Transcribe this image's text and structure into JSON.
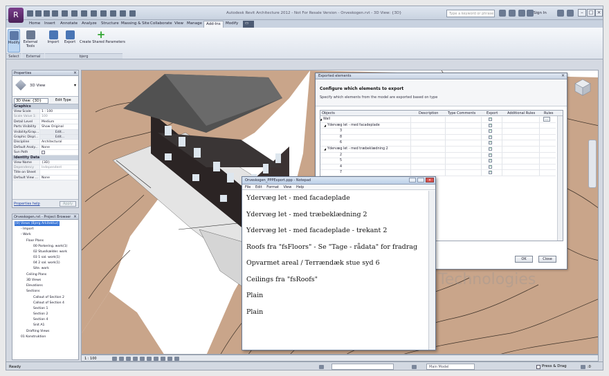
{
  "window": {
    "title": "Autodesk Revit Architecture 2012 - Not For Resale Version - Orveskogen.rvt - 3D View: {3D}",
    "search_placeholder": "Type a keyword or phrase",
    "sign_in": "Sign In"
  },
  "ribbon": {
    "tabs": [
      "Home",
      "Insert",
      "Annotate",
      "Analyze",
      "Structure",
      "Massing & Site",
      "Collaborate",
      "View",
      "Manage",
      "Add-Ins",
      "Modify"
    ],
    "active_tab": "Add-Ins",
    "buttons": {
      "modify": "Modify",
      "external_tools": "External Tools",
      "import": "Import",
      "export": "Export",
      "create_shared_params": "Create Shared Parameters"
    },
    "panels": {
      "select": "Select",
      "external": "External",
      "bjerg": "bjerg"
    }
  },
  "properties": {
    "header": "Properties",
    "type_name": "3D View",
    "view_selector": "3D View: {3D}",
    "edit_type": "Edit Type",
    "sections": {
      "graphics": "Graphics",
      "identity": "Identity Data"
    },
    "graphics_rows": [
      {
        "k": "View Scale",
        "v": "1 : 100"
      },
      {
        "k": "Scale Value   1:",
        "v": "100"
      },
      {
        "k": "Detail Level",
        "v": "Medium"
      },
      {
        "k": "Parts Visibility",
        "v": "Show Original"
      },
      {
        "k": "Visibility/Grap...",
        "v": "Edit..."
      },
      {
        "k": "Graphic Displ...",
        "v": "Edit..."
      },
      {
        "k": "Discipline",
        "v": "Architectural"
      },
      {
        "k": "Default Analy...",
        "v": "None"
      },
      {
        "k": "Sun Path",
        "v": ""
      }
    ],
    "identity_rows": [
      {
        "k": "View Name",
        "v": "{3D}"
      },
      {
        "k": "Dependency",
        "v": "Independent"
      },
      {
        "k": "Title on Sheet",
        "v": ""
      },
      {
        "k": "Default View ...",
        "v": "None"
      }
    ],
    "help": "Properties help",
    "apply": "Apply"
  },
  "browser": {
    "header": "Orveskogen.rvt - Project Browser",
    "nodes": [
      "[0] Views (Bjerg Arkitektur)",
      "- Import",
      "- Work",
      "Floor Plans",
      "00 Parkering. work(1)",
      "02 Stue/kælder. work",
      "03 1 sal. work(1)",
      "04 2 sal. work(1)",
      "Site. work",
      "Ceiling Plans",
      "3D Views",
      "Elevations",
      "Sections",
      "Callout of Section 2",
      "Callout of Section 4",
      "Section 1",
      "Section 2",
      "Section 4",
      "Snit A1",
      "Drafting Views",
      "01 Konstruktion"
    ]
  },
  "view_bar": {
    "scale": "1 : 100"
  },
  "status": {
    "text": "Ready",
    "model": "Main Model",
    "press_drag": "Press & Drag",
    "select_count": ":0"
  },
  "watermark": "Ollo Technologies",
  "export_dialog": {
    "title": "Exported elements",
    "heading": "Configure which elements to export",
    "subheading": "Specify which elements from the model are exported based on type",
    "columns": [
      "Objects",
      "Description",
      "Type Comments",
      "Export",
      "Additional Rules",
      "Rules"
    ],
    "rows": [
      {
        "name": "Wall",
        "level": 0
      },
      {
        "name": "Ydervæg let - med facadeplade",
        "level": 1
      },
      {
        "name": "3",
        "level": 2
      },
      {
        "name": "8",
        "level": 2
      },
      {
        "name": "6",
        "level": 2
      },
      {
        "name": "Ydervæg let - med træbeklædning 2",
        "level": 1
      },
      {
        "name": "2",
        "level": 2
      },
      {
        "name": "5",
        "level": 2
      },
      {
        "name": "4",
        "level": 2
      },
      {
        "name": "7",
        "level": 2
      }
    ],
    "ok": "OK",
    "close": "Close"
  },
  "notepad": {
    "title": "Orveskogen_PPPExport.ppp - Notepad",
    "menu": [
      "File",
      "Edit",
      "Format",
      "View",
      "Help"
    ],
    "lines": [
      "Ydervæg let - med facadeplade",
      "Ydervæg let - med træbeklædning 2",
      "Ydervæg let - med facadeplade - trekant 2",
      "Roofs fra \"fsFloors\" - Se \"Tage - rådata\" for fradrag",
      "Opvarmet areal / Terrændæk stue syd 6",
      "Ceilings fra \"fsRoofs\"",
      "Plain",
      "Plain"
    ]
  }
}
